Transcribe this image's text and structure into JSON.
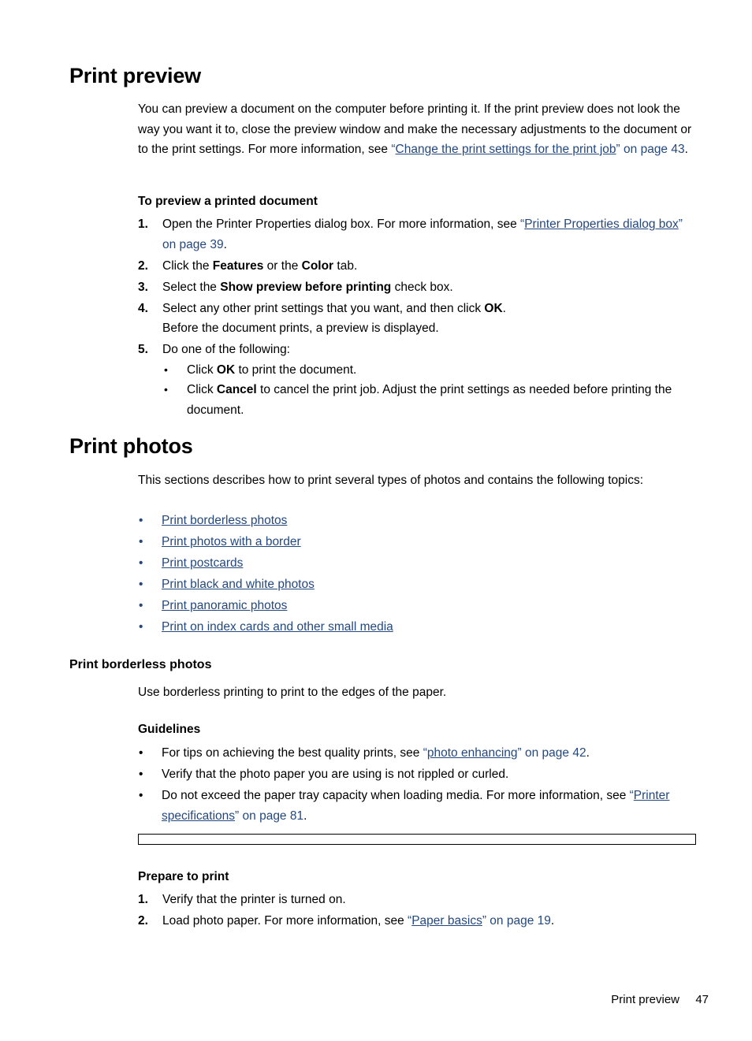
{
  "page": {
    "section_heading_1": "Print preview",
    "section_heading_2": "Print photos",
    "subheading_borderless": "Print borderless photos"
  },
  "print_preview": {
    "intro": {
      "part1": "You can preview a document on the computer before printing it. If the print preview does not look the way you want it to, close the preview window and make the necessary adjustments to the document or to the print settings. For more information, see ",
      "quote_open": "“",
      "link": "Change the print settings for the print job",
      "quote_close": "”",
      "link_suffix": " on page 43",
      "part_end": "."
    },
    "procedure_title": "To preview a printed document",
    "steps": [
      {
        "num": "1.",
        "text_before": "Open the Printer Properties dialog box. For more information, see ",
        "quote_open": "“",
        "link": "Printer Properties dialog box",
        "quote_close": "”",
        "link_suffix": " on page 39",
        "text_after": "."
      },
      {
        "num": "2.",
        "text_before": "Click the ",
        "bold1": "Features",
        "text_mid": " or the ",
        "bold2": "Color",
        "text_after": " tab."
      },
      {
        "num": "3.",
        "text_before": "Select the ",
        "bold1": "Show preview before printing",
        "text_after": " check box."
      },
      {
        "num": "4.",
        "text_before": "Select any other print settings that you want, and then click ",
        "bold1": "OK",
        "text_after": ".",
        "extra_line": "Before the document prints, a preview is displayed."
      },
      {
        "num": "5.",
        "text_before": "Do one of the following:",
        "sub_bullets": [
          {
            "bullet": "•",
            "text_before": "Click ",
            "bold1": "OK",
            "text_after": " to print the document."
          },
          {
            "bullet": "•",
            "text_before": "Click ",
            "bold1": "Cancel",
            "text_after": " to cancel the print job. Adjust the print settings as needed before printing the document."
          }
        ]
      }
    ]
  },
  "print_photos": {
    "intro": "This sections describes how to print several types of photos and contains the following topics:",
    "topic_links": [
      {
        "bullet": "•",
        "label": "Print borderless photos"
      },
      {
        "bullet": "•",
        "label": "Print photos with a border"
      },
      {
        "bullet": "•",
        "label": "Print postcards"
      },
      {
        "bullet": "•",
        "label": "Print black and white photos"
      },
      {
        "bullet": "•",
        "label": "Print panoramic photos"
      },
      {
        "bullet": "•",
        "label": "Print on index cards and other small media"
      }
    ]
  },
  "borderless": {
    "intro": "Use borderless printing to print to the edges of the paper.",
    "guidelines_title": "Guidelines",
    "guidelines": [
      {
        "bullet": "•",
        "text_before": "For tips on achieving the best quality prints, see ",
        "quote_open": "“",
        "link": "photo enhancing",
        "quote_close": "”",
        "link_suffix": " on page 42",
        "text_after": "."
      },
      {
        "bullet": "•",
        "text_before": "Verify that the photo paper you are using is not rippled or curled."
      },
      {
        "bullet": "•",
        "text_before": "Do not exceed the paper tray capacity when loading media. For more information, see ",
        "quote_open": "“",
        "link": "Printer specifications",
        "quote_close": "”",
        "link_suffix": " on page 81",
        "text_after": "."
      }
    ],
    "prepare_title": "Prepare to print",
    "prepare_steps": [
      {
        "num": "1.",
        "text_before": "Verify that the printer is turned on."
      },
      {
        "num": "2.",
        "text_before": "Load photo paper. For more information, see ",
        "quote_open": "“",
        "link": "Paper basics",
        "quote_close": "”",
        "link_suffix": " on page 19",
        "text_after": "."
      }
    ]
  },
  "footer": {
    "title": "Print preview",
    "page_number": "47"
  },
  "colors": {
    "link": "#24487E",
    "text": "#000000",
    "background": "#FFFFFF"
  }
}
